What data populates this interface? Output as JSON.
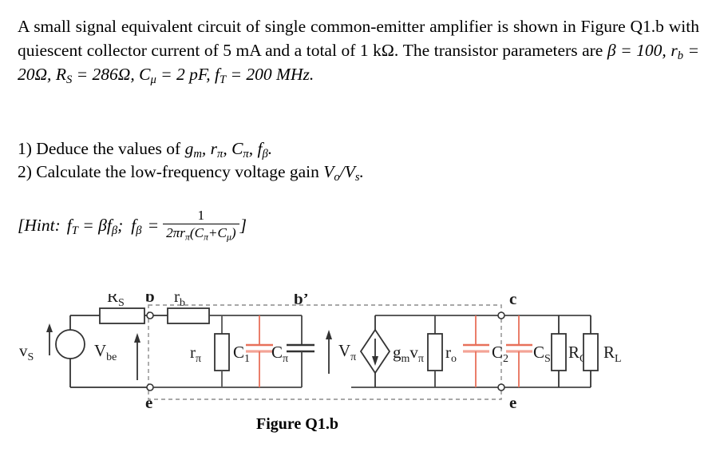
{
  "document": {
    "problem": {
      "line1": "A small signal equivalent circuit of single common-emitter amplifier is",
      "line2": "shown in Figure Q1.b with quiescent collector current of 5 mA and a total",
      "line3_pre": "of 1 kΩ. The transistor parameters are",
      "beta_value": "β = 100,",
      "rb_value_pre": "r",
      "rb_value_sub": "b",
      "rb_value_post": " = 20Ω,",
      "rs_value_pre": "R",
      "rs_value_sub": "S",
      "rs_value_post": " =",
      "line4_rs": "286Ω,",
      "cmu_pre": "C",
      "cmu_sub": "μ",
      "cmu_post": " = 2 pF,",
      "ft_pre": "f",
      "ft_sub": "T",
      "ft_post": " = 200 MHz."
    },
    "questions": [
      {
        "number": "1)",
        "text": "Deduce the values of",
        "symbols": "g_m, r_π, C_π, f_β."
      },
      {
        "number": "2)",
        "text": "Calculate the low-frequency voltage gain",
        "symbols": "V_o/V_s."
      }
    ],
    "hint": {
      "open_bracket": "[",
      "label": "Hint:",
      "eq1": "f_T = β f_β;",
      "eq2_lhs": "f_β",
      "equals": "=",
      "numerator": "1",
      "denominator": "2πr_π(C_π+C_μ)",
      "close_bracket": "]"
    },
    "figure": {
      "caption": "Figure Q1.b",
      "labels": {
        "vs": "v",
        "vs_sub": "S",
        "rs": "R",
        "rs_sub": "S",
        "node_b": "b",
        "vbe": "V",
        "vbe_sub": "be",
        "rb": "r",
        "rb_sub": "b",
        "rpi": "r",
        "rpi_sub": "π",
        "c1": "C",
        "c1_sub": "1",
        "cpi": "C",
        "cpi_sub": "π",
        "node_bprime": "b'",
        "vpi": "V",
        "vpi_sub": "π",
        "node_e_left": "e",
        "gmvpi": "g",
        "gmvpi_sub1": "m",
        "gmvpi_v": "v",
        "gmvpi_sub2": "π",
        "ro": "r",
        "ro_sub": "o",
        "c2": "C",
        "c2_sub": "2",
        "node_c": "c",
        "cs": "C",
        "cs_sub": "S",
        "rc": "R",
        "rc_sub": "C",
        "rl": "R",
        "rl_sub": "L",
        "node_e_right": "e"
      },
      "colors": {
        "wire": "#333333",
        "capacitor_red": "#E8705A",
        "capacitor_red_light": "#F3A396",
        "dashed_box": "#888888",
        "text": "#1a1a1a"
      }
    }
  }
}
